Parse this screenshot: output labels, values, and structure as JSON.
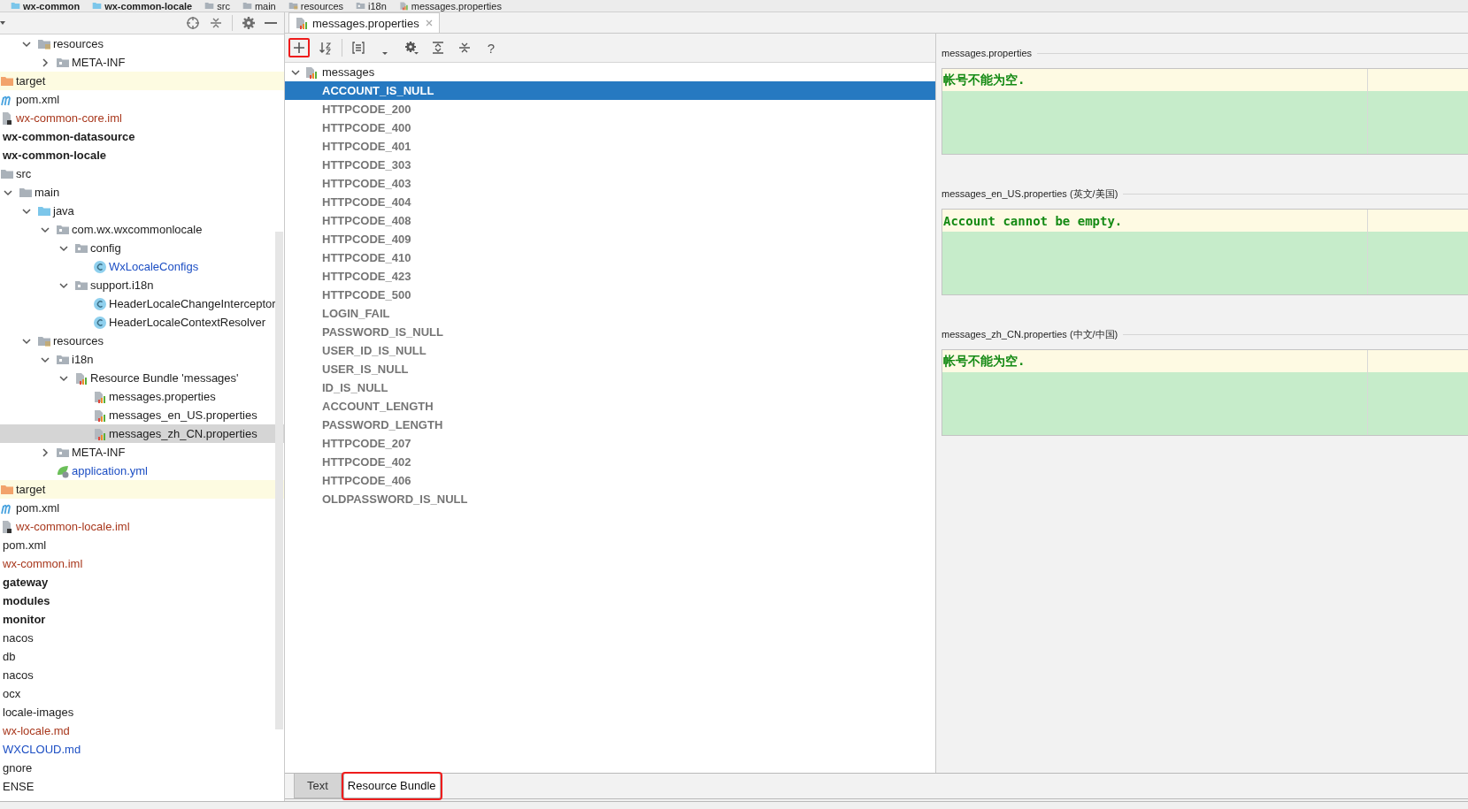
{
  "breadcrumbs": [
    {
      "label": "wx-common",
      "kind": "module"
    },
    {
      "label": "wx-common-locale",
      "kind": "module"
    },
    {
      "label": "src",
      "kind": "folder"
    },
    {
      "label": "main",
      "kind": "folder"
    },
    {
      "label": "resources",
      "kind": "folder-resources"
    },
    {
      "label": "i18n",
      "kind": "package"
    },
    {
      "label": "messages.properties",
      "kind": "properties"
    }
  ],
  "project_tree": [
    {
      "children": [
        {
          "children": [
            {
              "children": [
                {
                  "label": "resources",
                  "kind": "folder-resources",
                  "expanded": true,
                  "selected": false,
                  "children": [
                    {
                      "label": "META-INF",
                      "kind": "package",
                      "expanded": false,
                      "selected": false
                    }
                  ]
                }
              ]
            }
          ]
        },
        {
          "label": "target",
          "kind": "folder-excluded",
          "selected": false
        },
        {
          "label": "pom.xml",
          "kind": "maven",
          "selected": false
        },
        {
          "label": "wx-common-core.iml",
          "kind": "iml",
          "color": "#a8371c",
          "selected": false
        }
      ]
    },
    {
      "label": "wx-common-datasource",
      "kind": "module",
      "selected": false
    },
    {
      "label": "wx-common-locale",
      "kind": "module",
      "selected": false,
      "children": [
        {
          "label": "src",
          "kind": "folder",
          "selected": false,
          "children": [
            {
              "label": "main",
              "kind": "folder",
              "expanded": true,
              "selected": false,
              "children": [
                {
                  "label": "java",
                  "kind": "folder-source",
                  "expanded": true,
                  "selected": false,
                  "children": [
                    {
                      "label": "com.wx.wxcommonlocale",
                      "kind": "package",
                      "expanded": true,
                      "selected": false,
                      "children": [
                        {
                          "label": "config",
                          "kind": "package",
                          "expanded": true,
                          "selected": false,
                          "children": [
                            {
                              "label": "WxLocaleConfigs",
                              "kind": "class",
                              "color": "#1d4fc4",
                              "selected": false
                            }
                          ]
                        },
                        {
                          "label": "support.i18n",
                          "kind": "package",
                          "expanded": true,
                          "selected": false,
                          "children": [
                            {
                              "label": "HeaderLocaleChangeInterceptor",
                              "kind": "class",
                              "selected": false
                            },
                            {
                              "label": "HeaderLocaleContextResolver",
                              "kind": "class",
                              "selected": false
                            }
                          ]
                        }
                      ]
                    }
                  ]
                },
                {
                  "label": "resources",
                  "kind": "folder-resources",
                  "expanded": true,
                  "selected": false,
                  "children": [
                    {
                      "label": "i18n",
                      "kind": "package",
                      "expanded": true,
                      "selected": false,
                      "children": [
                        {
                          "label": "Resource Bundle 'messages'",
                          "kind": "bundle",
                          "expanded": true,
                          "selected": false,
                          "children": [
                            {
                              "label": "messages.properties",
                              "kind": "properties",
                              "selected": false
                            },
                            {
                              "label": "messages_en_US.properties",
                              "kind": "properties",
                              "selected": false
                            },
                            {
                              "label": "messages_zh_CN.properties",
                              "kind": "properties",
                              "selected": true
                            }
                          ]
                        }
                      ]
                    },
                    {
                      "label": "META-INF",
                      "kind": "package",
                      "expanded": false,
                      "selected": false
                    },
                    {
                      "label": "application.yml",
                      "kind": "spring",
                      "color": "#1d4fc4",
                      "selected": false
                    }
                  ]
                }
              ]
            }
          ]
        },
        {
          "label": "target",
          "kind": "folder-excluded",
          "selected": false
        },
        {
          "label": "pom.xml",
          "kind": "maven",
          "selected": false
        },
        {
          "label": "wx-common-locale.iml",
          "kind": "iml",
          "color": "#a8371c",
          "selected": false
        }
      ]
    },
    {
      "label": "pom.xml",
      "kind": "file",
      "selected": false
    },
    {
      "label": "wx-common.iml",
      "kind": "file",
      "color": "#a8371c",
      "selected": false
    },
    {
      "label": "gateway",
      "kind": "module",
      "selected": false
    },
    {
      "label": "modules",
      "kind": "module",
      "selected": false
    },
    {
      "label": "monitor",
      "kind": "module",
      "selected": false
    },
    {
      "label": "nacos",
      "kind": "file",
      "selected": false
    },
    {
      "label": "db",
      "kind": "file",
      "selected": false
    },
    {
      "label": "nacos",
      "kind": "file",
      "selected": false
    },
    {
      "label": "ocx",
      "kind": "file",
      "selected": false
    },
    {
      "label": "locale-images",
      "kind": "file",
      "selected": false
    },
    {
      "label": "wx-locale.md",
      "kind": "file",
      "color": "#a8371c",
      "selected": false
    },
    {
      "label": "WXCLOUD.md",
      "kind": "file",
      "color": "#1d4fc4",
      "selected": false
    },
    {
      "label": "gnore",
      "kind": "file",
      "selected": false
    },
    {
      "label": "ENSE",
      "kind": "file",
      "selected": false
    }
  ],
  "editor_tabs": [
    {
      "label": "messages.properties",
      "selected": true
    }
  ],
  "toolbar": [
    {
      "kind": "add",
      "marked": true
    },
    {
      "kind": "sort"
    },
    {
      "kind": "separator"
    },
    {
      "kind": "group"
    },
    {
      "kind": "dropdown"
    },
    {
      "kind": "settings"
    },
    {
      "kind": "expand"
    },
    {
      "kind": "collapse"
    },
    {
      "kind": "help",
      "label": "?"
    }
  ],
  "bundle": {
    "name": "messages",
    "expanded": true,
    "keys": [
      {
        "label": "ACCOUNT_IS_NULL",
        "selected": true
      },
      {
        "label": "HTTPCODE_200",
        "selected": false
      },
      {
        "label": "HTTPCODE_400",
        "selected": false
      },
      {
        "label": "HTTPCODE_401",
        "selected": false
      },
      {
        "label": "HTTPCODE_303",
        "selected": false
      },
      {
        "label": "HTTPCODE_403",
        "selected": false
      },
      {
        "label": "HTTPCODE_404",
        "selected": false
      },
      {
        "label": "HTTPCODE_408",
        "selected": false
      },
      {
        "label": "HTTPCODE_409",
        "selected": false
      },
      {
        "label": "HTTPCODE_410",
        "selected": false
      },
      {
        "label": "HTTPCODE_423",
        "selected": false
      },
      {
        "label": "HTTPCODE_500",
        "selected": false
      },
      {
        "label": "LOGIN_FAIL",
        "selected": false
      },
      {
        "label": "PASSWORD_IS_NULL",
        "selected": false
      },
      {
        "label": "USER_ID_IS_NULL",
        "selected": false
      },
      {
        "label": "USER_IS_NULL",
        "selected": false
      },
      {
        "label": "ID_IS_NULL",
        "selected": false
      },
      {
        "label": "ACCOUNT_LENGTH",
        "selected": false
      },
      {
        "label": "PASSWORD_LENGTH",
        "selected": false
      },
      {
        "label": "HTTPCODE_207",
        "selected": false
      },
      {
        "label": "HTTPCODE_402",
        "selected": false
      },
      {
        "label": "HTTPCODE_406",
        "selected": false
      },
      {
        "label": "OLDPASSWORD_IS_NULL",
        "selected": false
      }
    ]
  },
  "translations": [
    {
      "title": "messages.properties",
      "value": "帐号不能为空."
    },
    {
      "title": "messages_en_US.properties (英文/美国)",
      "value": "Account cannot be empty."
    },
    {
      "title": "messages_zh_CN.properties (中文/中国)",
      "value": "帐号不能为空."
    }
  ],
  "bottom_tabs": [
    {
      "label": "Text",
      "selected": false,
      "marked": false
    },
    {
      "label": "Resource Bundle",
      "selected": true,
      "marked": true
    }
  ]
}
